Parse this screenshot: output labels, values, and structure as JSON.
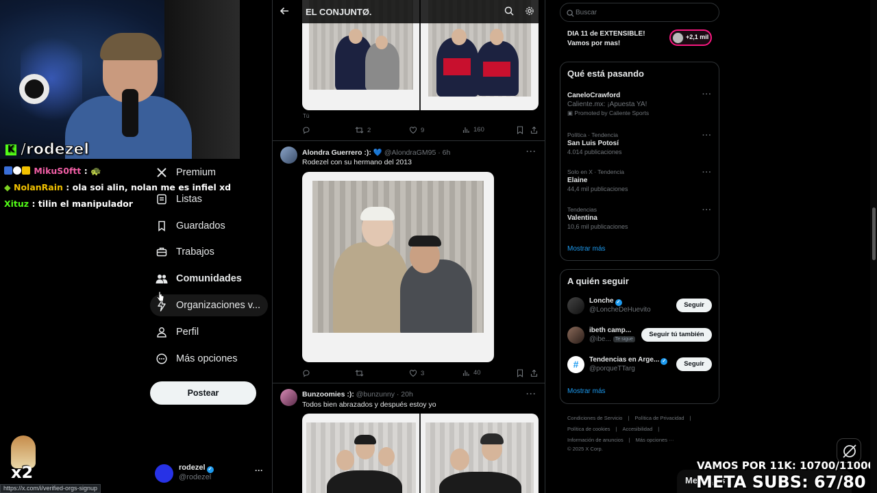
{
  "stream": {
    "channel": "/rodezel",
    "chat": [
      {
        "user": "MikuS0ftt",
        "user_color": "#f25fa6",
        "message": ":",
        "badges": [
          "#3a6fd8",
          "#ffffff",
          "#f2c200"
        ],
        "emoji": "🐢"
      },
      {
        "user": "NolanRain",
        "user_color": "#f2c200",
        "message": ": ola soi alin, nolan me es infiel xd",
        "badges": [
          "#7ed321"
        ]
      },
      {
        "user": "Xituz",
        "user_color": "#53fc18",
        "message": ": tilin el manipulador",
        "badges": []
      }
    ],
    "emote_label": "x2",
    "goal_line1": "VAMOS POR 11K: 10700/11000",
    "goal_line2": "META SUBS: 67/80"
  },
  "browser": {
    "status_url": "https://x.com/i/verified-orgs-signup"
  },
  "nav": {
    "items": [
      {
        "label": "Premium",
        "icon": "x-logo-icon"
      },
      {
        "label": "Listas",
        "icon": "list-icon"
      },
      {
        "label": "Guardados",
        "icon": "bookmark-icon"
      },
      {
        "label": "Trabajos",
        "icon": "briefcase-icon"
      },
      {
        "label": "Comunidades",
        "icon": "communities-icon"
      },
      {
        "label": "Organizaciones v...",
        "icon": "lightning-icon"
      },
      {
        "label": "Perfil",
        "icon": "person-icon"
      },
      {
        "label": "Más opciones",
        "icon": "more-circle-icon"
      }
    ],
    "post_button": "Postear",
    "account": {
      "name": "rodezel",
      "handle": "@rodezel",
      "more": "···"
    }
  },
  "center": {
    "title": "EL CONJUNTØ.",
    "first_tweet": {
      "caption": "Tú",
      "actions": {
        "replies": "",
        "reposts": "2",
        "likes": "9",
        "views": "160"
      }
    },
    "tweets": [
      {
        "name": "Alondra Guerrero :):",
        "heart": "💙",
        "handle": "@AlondraGM95",
        "time": "6h",
        "text": "Rodezel con su hermano del 2013",
        "actions": {
          "replies": "",
          "reposts": "",
          "likes": "3",
          "views": "40"
        }
      },
      {
        "name": "Bunzoomies :):",
        "handle": "@bunzunny",
        "time": "20h",
        "text": "Todos bien abrazados y después estoy yo"
      }
    ]
  },
  "right": {
    "search_placeholder": "Buscar",
    "live": {
      "line1": "DIA 11 de EXTENSIBLE!",
      "line2": "Vamos por mas!",
      "count": "+2,1 mil"
    },
    "trending": {
      "title": "Qué está pasando",
      "items": [
        {
          "context": "",
          "name": "CaneloCrawford",
          "sub": "Caliente.mx: ¡Apuesta YA!",
          "promoted": "Promoted by Caliente Sports"
        },
        {
          "context": "Política · Tendencia",
          "name": "San Luis Potosí",
          "sub": "4.014 publicaciones"
        },
        {
          "context": "Solo en X · Tendencia",
          "name": "Elaine",
          "sub": "44,4 mil publicaciones"
        },
        {
          "context": "Tendencias",
          "name": "Valentina",
          "sub": "10,6 mil publicaciones"
        }
      ],
      "show_more": "Mostrar más"
    },
    "who_to_follow": {
      "title": "A quién seguir",
      "items": [
        {
          "name": "Lonche",
          "handle": "@LoncheDeHuevito",
          "button": "Seguir",
          "verified": true
        },
        {
          "name": "ibeth camp...",
          "handle": "@ibe...",
          "tag": "Te sigue",
          "button": "Seguir tú también",
          "verified": false
        },
        {
          "name": "Tendencias en Arge...",
          "handle": "@porqueTTarg",
          "button": "Seguir",
          "verified": true
        }
      ],
      "show_more": "Mostrar más"
    },
    "footer": [
      "Condiciones de Servicio",
      "Política de Privacidad",
      "Política de cookies",
      "Accesibilidad",
      "Información de anuncios",
      "Más opciones ···",
      "© 2025 X Corp."
    ],
    "messages_label": "Mensajes"
  },
  "colors": {
    "accent": "#1d9bf0",
    "live_pink": "#f91880",
    "kick_green": "#53fc18"
  }
}
